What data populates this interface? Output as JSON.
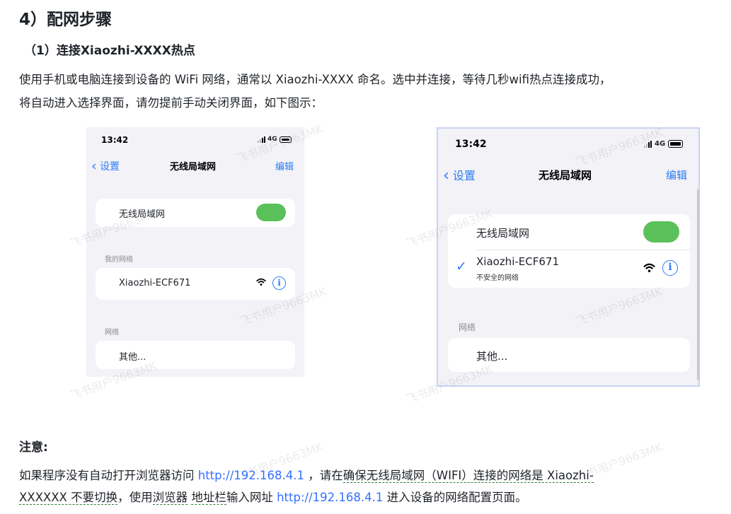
{
  "doc": {
    "heading": "4）配网步骤",
    "subheading": "（1）连接Xiaozhi-XXXX热点",
    "para1_line1": "使用手机或电脑连接到设备的 WiFi 网络，通常以 Xiaozhi-XXXX 命名。选中并连接，等待几秒wifi热点连接成功，",
    "para1_line2": "将自动进入选择界面，请勿提前手动关闭界面，如下图示：",
    "note_label": "注意:",
    "note_p1": "如果程序没有自动打开浏览器访问 ",
    "note_link1": "http://192.168.4.1",
    "note_p2": " ，请在",
    "note_u1": "确保无线局域网（WIFI）连接的网络是 Xiaozhi-",
    "note_u2": "XXXXXX 不要切换",
    "note_p3": "，使用",
    "note_u3": "浏览器",
    "note_p4": " ",
    "note_u4": "地址栏",
    "note_p5": "输入网址 ",
    "note_link2": "http://192.168.4.1",
    "note_p6": " 进入设备的网络配置页面。",
    "watermark": "飞书用户9663MK"
  },
  "phone1": {
    "time": "13:42",
    "network": "4G",
    "back": "设置",
    "title": "无线局域网",
    "edit": "编辑",
    "wlan_label": "无线局域网",
    "wlan_on": true,
    "my_networks": "我的网络",
    "ssid": "Xiaozhi-ECF671",
    "networks": "网络",
    "other": "其他..."
  },
  "phone2": {
    "time": "13:42",
    "network": "4G",
    "back": "设置",
    "title": "无线局域网",
    "edit": "编辑",
    "wlan_label": "无线局域网",
    "wlan_on": true,
    "ssid": "Xiaozhi-ECF671",
    "ssid_sub": "不安全的网络",
    "networks": "网络",
    "other": "其他..."
  }
}
